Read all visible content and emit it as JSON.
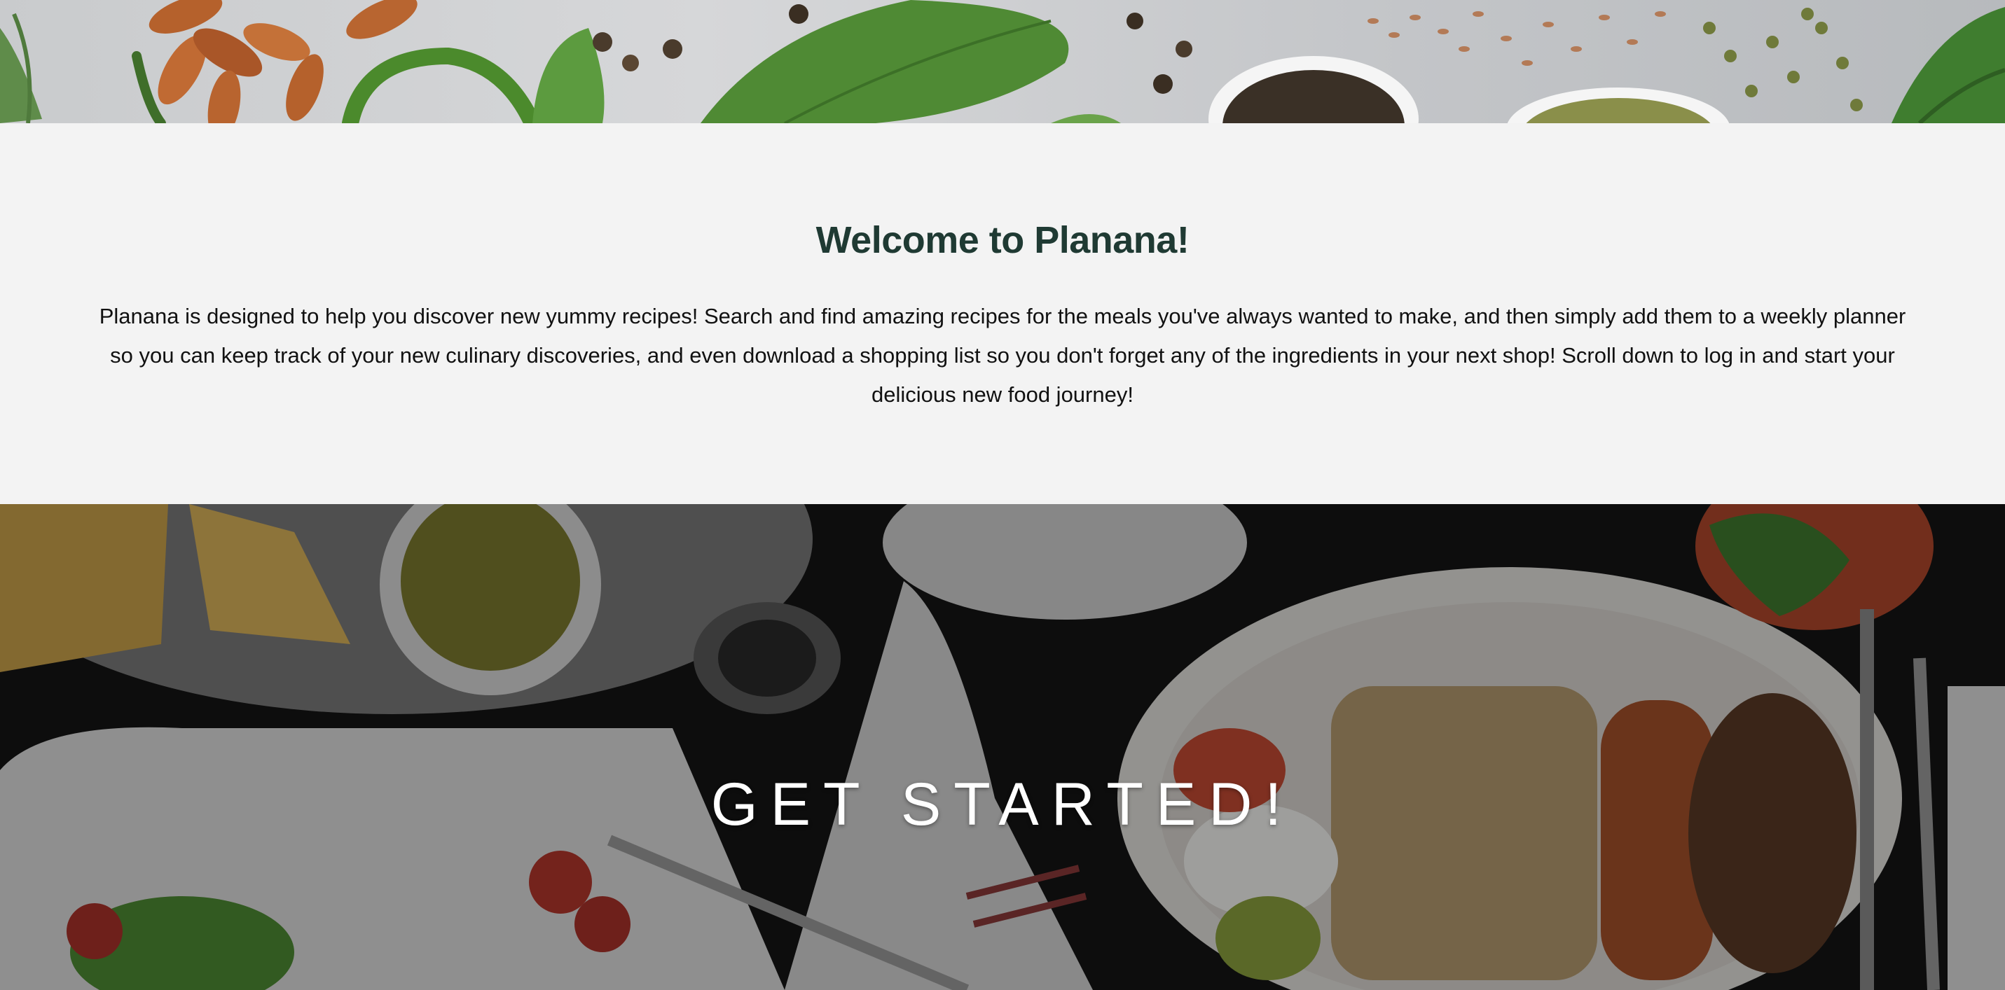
{
  "intro": {
    "title": "Welcome to Planana!",
    "text": "Planana is designed to help you discover new yummy recipes! Search and find amazing recipes for the meals you've always wanted to make, and then simply add them to a weekly planner so you can keep track of your new culinary discoveries, and even download a shopping list so you don't forget any of the ingredients in your next shop! Scroll down to log in and start your delicious new food journey!"
  },
  "hero": {
    "title": "GET STARTED!"
  },
  "colors": {
    "title_green": "#1f3a33",
    "section_bg": "#f3f3f3",
    "hero_text": "#ffffff"
  }
}
